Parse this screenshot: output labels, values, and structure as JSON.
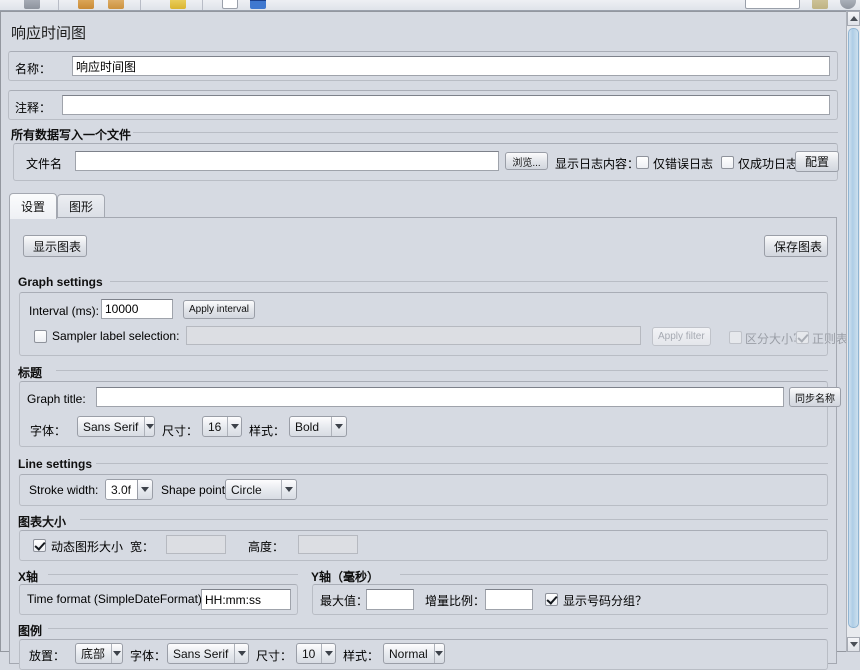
{
  "window": {
    "title": "响应时间图"
  },
  "toolbar": {
    "icons": [
      "save-icon",
      "open-icon",
      "copy-icon",
      "paste-icon",
      "clear-icon",
      "start-icon",
      "stop-icon"
    ]
  },
  "form": {
    "name_label": "名称：",
    "name_value": "响应时间图",
    "comment_label": "注释：",
    "comment_value": ""
  },
  "file_group": {
    "legend": "所有数据写入一个文件",
    "filename_label": "文件名",
    "filename_value": "",
    "browse_button": "浏览...",
    "log_label": "显示日志内容：",
    "errors_only": "仅错误日志",
    "success_only": "仅成功日志",
    "configure_button": "配置"
  },
  "tabs": [
    {
      "label": "设置",
      "active": true
    },
    {
      "label": "图形",
      "active": false
    }
  ],
  "actions": {
    "display_graph": "显示图表",
    "save_graph": "保存图表"
  },
  "graph_settings": {
    "legend": "Graph settings",
    "interval_label": "Interval (ms):",
    "interval_value": "10000",
    "apply_interval_button": "Apply interval",
    "sampler_label_selection": "Sampler label selection:",
    "sampler_filter_value": "",
    "apply_filter_button": "Apply filter",
    "case_sensitive": "区分大小写",
    "regex": "正则表达式"
  },
  "title_group": {
    "legend": "标题",
    "graph_title_label": "Graph title:",
    "graph_title_value": "",
    "sync_name_button": "同步名称",
    "font_label": "字体：",
    "font_value": "Sans Serif",
    "size_label": "尺寸：",
    "size_value": "16",
    "style_label": "样式：",
    "style_value": "Bold"
  },
  "line_settings": {
    "legend": "Line settings",
    "stroke_width_label": "Stroke width:",
    "stroke_width_value": "3.0f",
    "shape_point_label": "Shape point:",
    "shape_point_value": "Circle"
  },
  "chart_size": {
    "legend": "图表大小",
    "dynamic_size": "动态图形大小",
    "width_label": "宽：",
    "width_value": "",
    "height_label": "高度：",
    "height_value": ""
  },
  "x_axis": {
    "legend": "X轴",
    "time_format_label": "Time format (SimpleDateFormat):",
    "time_format_value": "HH:mm:ss"
  },
  "y_axis": {
    "legend": "Y轴（毫秒）",
    "max_label": "最大值：",
    "max_value": "",
    "increment_label": "增量比例：",
    "increment_value": "",
    "number_grouping": "显示号码分组？"
  },
  "legend_group": {
    "legend": "图例",
    "placement_label": "放置：",
    "placement_value": "底部",
    "font_label": "字体：",
    "font_value": "Sans Serif",
    "size_label": "尺寸：",
    "size_value": "10",
    "style_label": "样式：",
    "style_value": "Normal"
  },
  "colors": {
    "panel_bg": "#d6dae2",
    "field_bg": "#ffffff",
    "disabled_fg": "#9a9ea6",
    "border": "#b9bdc5",
    "scroll_thumb": "#aecde6"
  }
}
